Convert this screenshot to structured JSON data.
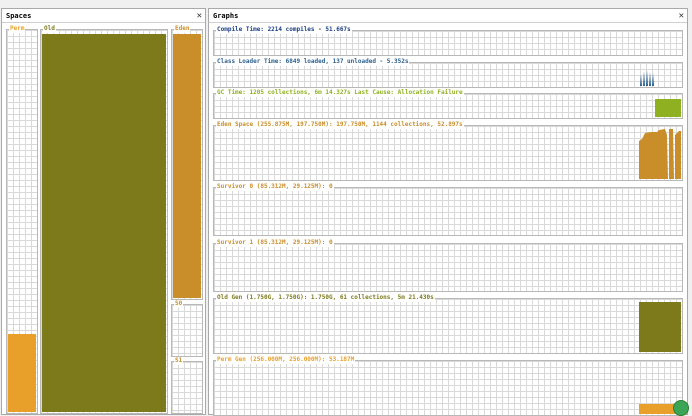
{
  "spaces": {
    "title": "Spaces",
    "close": "✕",
    "perm": {
      "label": "Perm",
      "color": "#e8a02a",
      "used": 0.24
    },
    "old": {
      "label": "Old",
      "color": "#7d7a1c",
      "used": 1.0
    },
    "eden": {
      "label": "Eden",
      "color": "#c98e2a",
      "used": 1.0
    },
    "s0": {
      "label": "S0"
    },
    "s1": {
      "label": "S1"
    }
  },
  "graphs": {
    "title": "Graphs",
    "close": "✕",
    "compile": {
      "label": "Compile Time: 2214 compiles - 51.667s",
      "color": "#1a3e82"
    },
    "classloader": {
      "label": "Class Loader Time: 6849 loaded, 137 unloaded - 5.352s",
      "color": "#2a5f8e"
    },
    "gc": {
      "label": "GC Time: 1205 collections, 6m 14.327s  Last Cause: Allocation Failure",
      "color": "#8fb020"
    },
    "eden": {
      "label": "Eden Space (255.875M, 197.750M): 197.750M, 1144 collections, 52.897s",
      "color": "#c98e2a"
    },
    "survivor0": {
      "label": "Survivor 0 (85.312M, 29.125M): 0",
      "color": "#c98e2a"
    },
    "survivor1": {
      "label": "Survivor 1 (85.312M, 29.125M): 0",
      "color": "#c98e2a"
    },
    "oldgen": {
      "label": "Old Gen (1.750G, 1.750G): 1.750G, 61 collections, 5m 21.430s",
      "color": "#7d7a1c"
    },
    "permgen": {
      "label": "Perm Gen (256.000M, 256.000M): 53.187M",
      "color": "#e8a02a"
    }
  }
}
